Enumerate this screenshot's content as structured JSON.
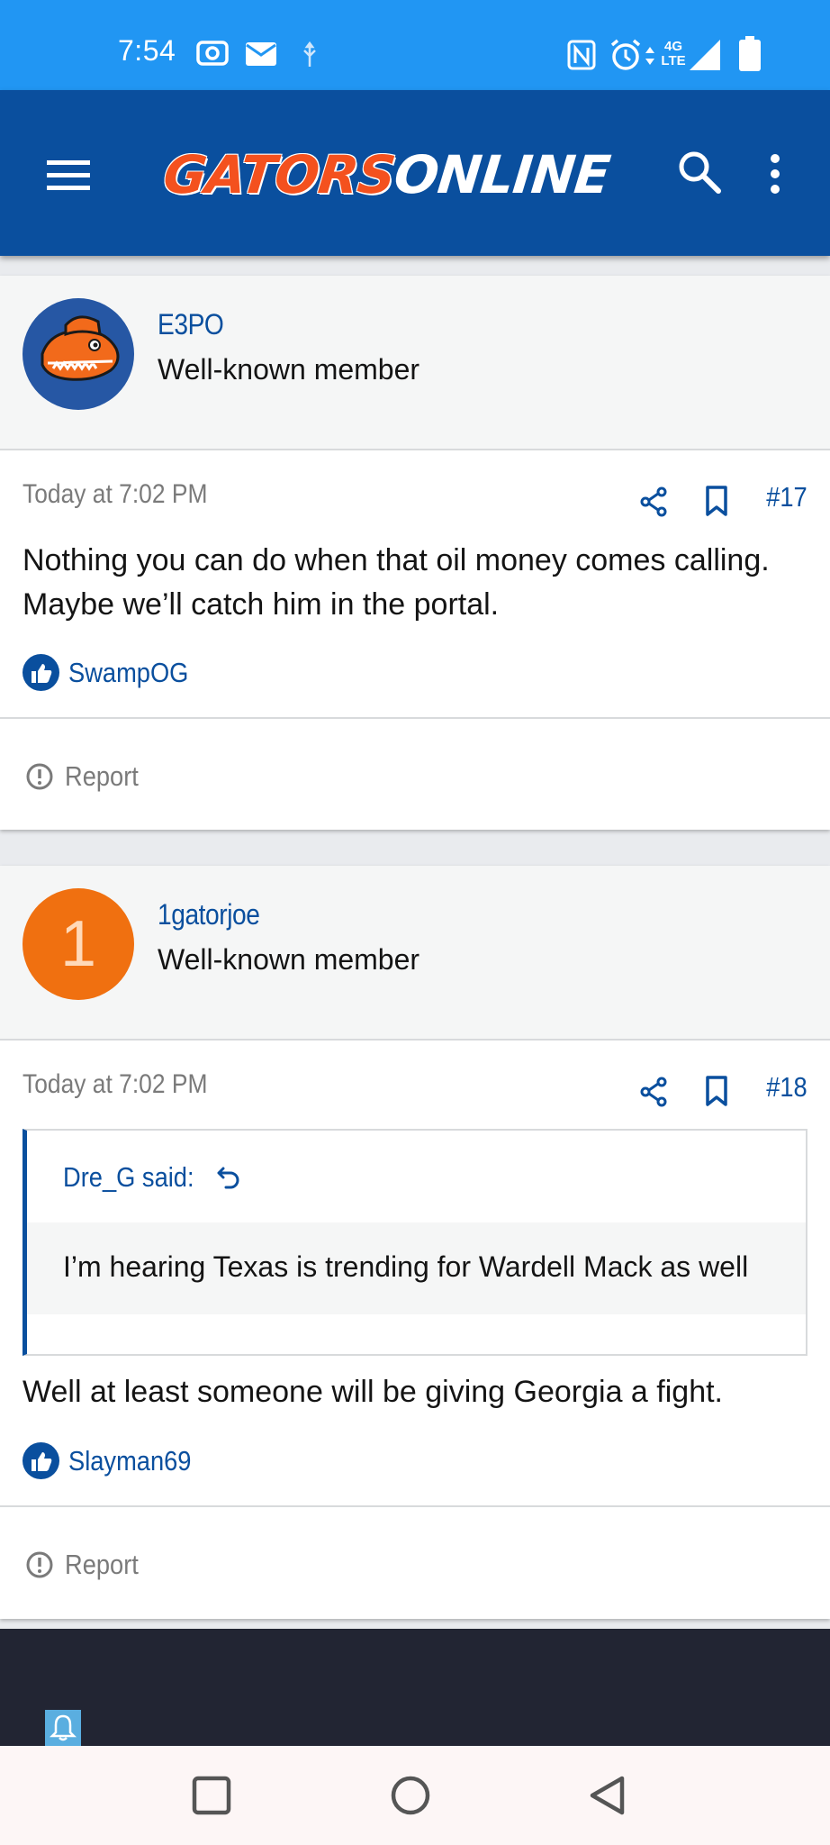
{
  "status_bar": {
    "time": "7:54",
    "network": "4G LTE",
    "icons": [
      "screen-record-icon",
      "mail-icon",
      "usb-icon",
      "nfc-icon",
      "alarm-icon",
      "signal-icon",
      "battery-icon"
    ]
  },
  "header": {
    "logo_part1": "GATORS",
    "logo_part2": "ONLINE",
    "icons": [
      "menu-icon",
      "search-icon",
      "more-vert-icon"
    ]
  },
  "posts": [
    {
      "username": "E3PO",
      "user_title": "Well-known member",
      "date": "Today at 7:02 PM",
      "post_number": "#17",
      "body": "Nothing you can do when that oil money comes calling. Maybe we’ll catch him in the portal.",
      "reaction_user": "SwampOG",
      "report_label": "Report"
    },
    {
      "username": "1gatorjoe",
      "avatar_letter": "1",
      "user_title": "Well-known member",
      "date": "Today at 7:02 PM",
      "post_number": "#18",
      "quote_author": "Dre_G said:",
      "quote_text": "I’m hearing Texas is trending for Wardell Mack as well",
      "body": "Well at least someone will be giving Georgia a fight.",
      "reaction_user": "Slayman69",
      "report_label": "Report"
    }
  ],
  "colors": {
    "status_bar": "#2196f3",
    "header": "#0a4f9e",
    "accent": "#0a4f9e",
    "logo_orange": "#f4511e",
    "avatar_orange": "#f07010",
    "footer": "#222533"
  }
}
